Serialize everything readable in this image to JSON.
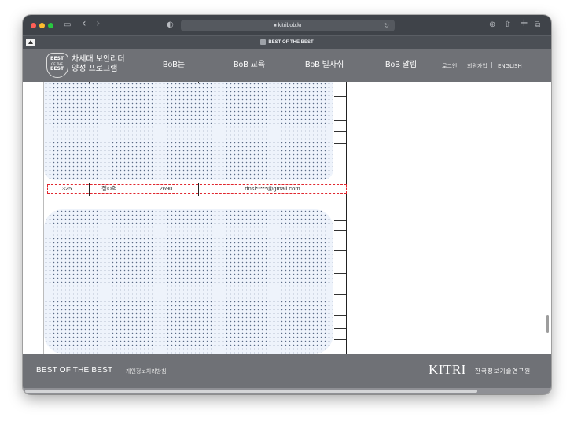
{
  "browser": {
    "url": "kitribob.kr",
    "tab_title": "BEST OF THE BEST",
    "back_icon": "‹",
    "forward_icon": "›",
    "shield_icon": "◐",
    "reload_icon": "↻",
    "download_icon": "⊕",
    "share_icon": "⇧",
    "newtab_icon": "+",
    "tabs_icon": "⧉",
    "sidebar_icon": "▭"
  },
  "site": {
    "logo_badge": {
      "top": "BEST",
      "middle": "OF THE",
      "bottom": "BEST"
    },
    "logo_line1": "차세대 보안리더",
    "logo_line2": "양성 프로그램",
    "nav": [
      "BoB는",
      "BoB 교육",
      "BoB 빌자취",
      "BoB 알림"
    ],
    "util": [
      "로그인",
      "회원가입",
      "ENGLISH"
    ]
  },
  "table_row": {
    "number": "325",
    "name": "정O혁",
    "code": "2690",
    "email": "dnsl*****@gmail.com"
  },
  "footer": {
    "title": "BEST OF THE BEST",
    "privacy": "개인정보처리방침",
    "org_logo": "KITRI",
    "org_name": "한국정보기술연구원"
  }
}
